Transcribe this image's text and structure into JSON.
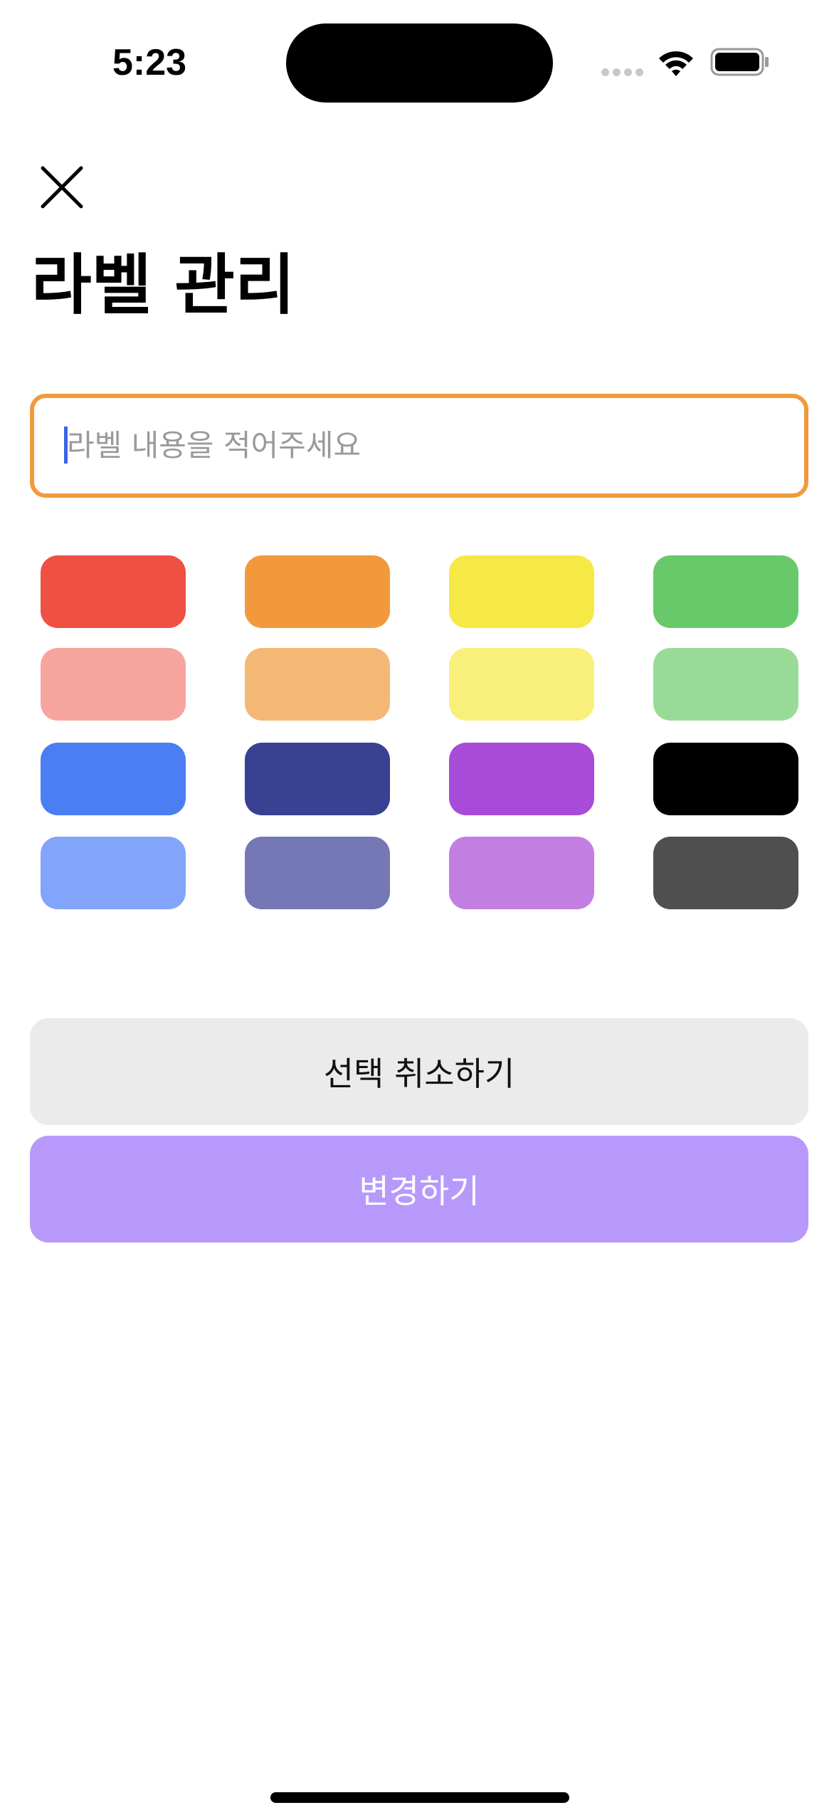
{
  "status_bar": {
    "time": "5:23",
    "icons": [
      "cellular-signal-icon",
      "wifi-icon",
      "battery-icon"
    ]
  },
  "header": {
    "close_icon": "close-icon",
    "title": "라벨 관리"
  },
  "label_input": {
    "value": "",
    "placeholder": "라벨 내용을 적어주세요",
    "border_color": "#f09a3c",
    "caret_color": "#3a64e8"
  },
  "colors": [
    [
      "#ee5044",
      "#f29a3b",
      "#f6e945",
      "#68c96b"
    ],
    [
      "#f5a59e",
      "#f4b774",
      "#f9f07c",
      "#98db97"
    ],
    [
      "#4b7ef3",
      "#394192",
      "#a84bd9",
      "#000000"
    ],
    [
      "#82a4fb",
      "#7479b5",
      "#c27fe1",
      "#4f4f4f"
    ]
  ],
  "actions": {
    "cancel_label": "선택 취소하기",
    "apply_label": "변경하기",
    "cancel_color": "#ebebeb",
    "apply_color": "#b799fb"
  }
}
